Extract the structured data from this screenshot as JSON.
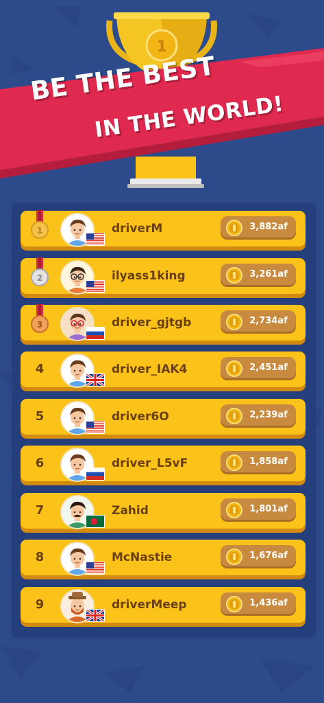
{
  "banner": {
    "line1": "BE THE BEST",
    "line2": "IN THE WORLD!"
  },
  "trophy": {
    "rank": "1"
  },
  "colors": {
    "background": "#2d4a8a",
    "panel": "#243f7c",
    "row": "#fbc21a",
    "banner": "#e0294f",
    "score_pill": "#c78a3e"
  },
  "leaderboard": [
    {
      "rank": "1",
      "medal": "gold",
      "name": "driverM",
      "score": "3,882af",
      "flag": "us",
      "avatar": "boy-brown"
    },
    {
      "rank": "2",
      "medal": "silver",
      "name": "ilyass1king",
      "score": "3,261af",
      "flag": "us",
      "avatar": "boy-glasses"
    },
    {
      "rank": "3",
      "medal": "bronze",
      "name": "driver_gjtgb",
      "score": "2,734af",
      "flag": "ru",
      "avatar": "girl-red-glasses"
    },
    {
      "rank": "4",
      "medal": "",
      "name": "driver_IAK4",
      "score": "2,451af",
      "flag": "gb",
      "avatar": "boy-brown"
    },
    {
      "rank": "5",
      "medal": "",
      "name": "driver6O",
      "score": "2,239af",
      "flag": "us",
      "avatar": "boy-brown"
    },
    {
      "rank": "6",
      "medal": "",
      "name": "driver_L5vF",
      "score": "1,858af",
      "flag": "ru",
      "avatar": "boy-brown"
    },
    {
      "rank": "7",
      "medal": "",
      "name": "Zahid",
      "score": "1,801af",
      "flag": "bd",
      "avatar": "man-mustache"
    },
    {
      "rank": "8",
      "medal": "",
      "name": "McNastie",
      "score": "1,676af",
      "flag": "us",
      "avatar": "boy-brown"
    },
    {
      "rank": "9",
      "medal": "",
      "name": "driverMeep",
      "score": "1,436af",
      "flag": "gb",
      "avatar": "man-beard-hat"
    }
  ]
}
